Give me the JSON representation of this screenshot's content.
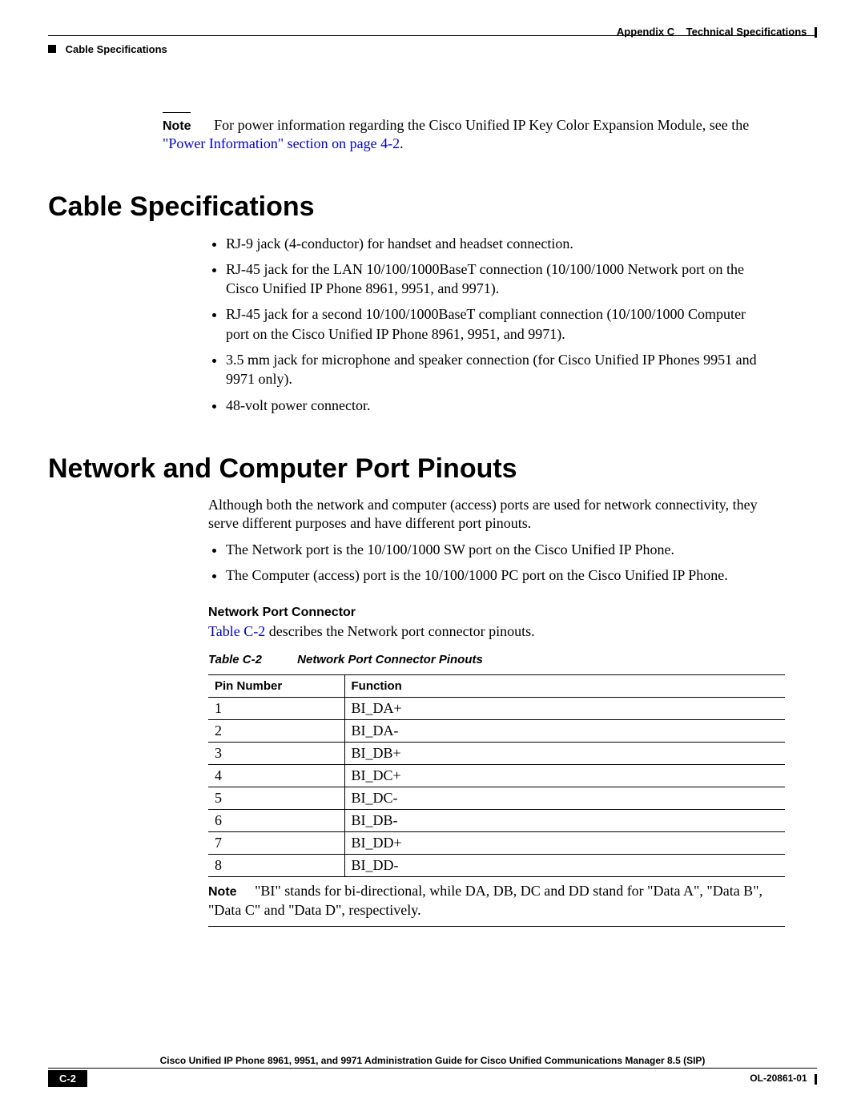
{
  "header": {
    "appendix": "Appendix C",
    "title": "Technical Specifications",
    "section": "Cable Specifications"
  },
  "note1": {
    "label": "Note",
    "text_before_link": "For power information regarding the Cisco Unified IP Key Color Expansion Module, see the ",
    "link_text": "\"Power Information\" section on page 4-2",
    "trailing": "."
  },
  "sec_cable": {
    "heading": "Cable Specifications",
    "bullets": [
      "RJ-9 jack (4-conductor) for handset and headset connection.",
      "RJ-45 jack for the LAN 10/100/1000BaseT connection (10/100/1000 Network port on the Cisco Unified IP Phone 8961, 9951, and 9971).",
      "RJ-45 jack for a second 10/100/1000BaseT compliant connection (10/100/1000 Computer port on the Cisco Unified IP Phone 8961, 9951, and 9971).",
      "3.5 mm jack for microphone and speaker connection (for Cisco Unified IP Phones 9951 and 9971 only).",
      "48-volt power connector."
    ]
  },
  "sec_pinouts": {
    "heading": "Network and Computer Port Pinouts",
    "intro": "Although both the network and computer (access) ports are used for network connectivity, they serve different purposes and have different port pinouts.",
    "bullets": [
      "The Network port is the 10/100/1000 SW port  on the Cisco Unified IP Phone.",
      "The Computer (access) port is the 10/100/1000 PC port  on the Cisco Unified IP Phone."
    ],
    "sub_heading": "Network Port Connector",
    "sub_desc_prefix": "",
    "sub_desc_link": "Table C-2",
    "sub_desc_suffix": " describes the Network port connector pinouts.",
    "table_caption_num": "Table C-2",
    "table_caption_title": "Network Port Connector Pinouts",
    "table": {
      "headers": [
        "Pin Number",
        "Function"
      ],
      "rows": [
        [
          "1",
          "BI_DA+"
        ],
        [
          "2",
          "BI_DA-"
        ],
        [
          "3",
          "BI_DB+"
        ],
        [
          "4",
          "BI_DC+"
        ],
        [
          "5",
          "BI_DC-"
        ],
        [
          "6",
          "BI_DB-"
        ],
        [
          "7",
          "BI_DD+"
        ],
        [
          "8",
          "BI_DD-"
        ]
      ]
    },
    "table_note_label": "Note",
    "table_note_text": "\"BI\" stands for bi-directional, while DA, DB, DC and DD stand for \"Data A\", \"Data B\", \"Data C\" and \"Data D\", respectively."
  },
  "footer": {
    "title": "Cisco Unified IP Phone 8961, 9951, and 9971 Administration Guide for Cisco Unified Communications Manager 8.5 (SIP)",
    "page": "C-2",
    "doc": "OL-20861-01"
  }
}
